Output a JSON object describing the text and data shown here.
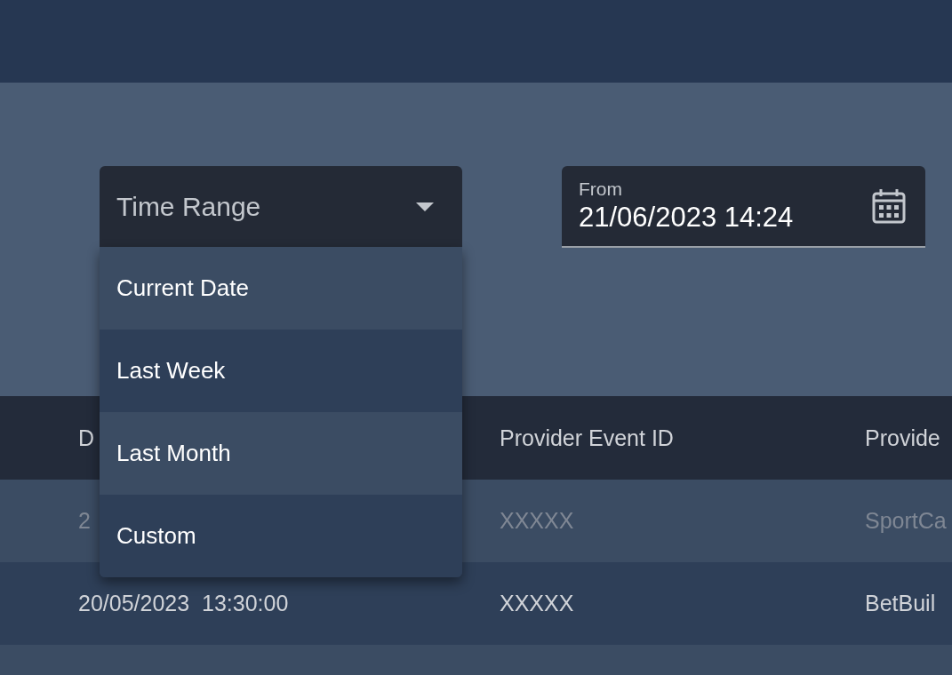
{
  "filter": {
    "time_range": {
      "placeholder": "Time Range",
      "expanded": true,
      "options": [
        {
          "label": "Current Date"
        },
        {
          "label": "Last Week"
        },
        {
          "label": "Last Month"
        },
        {
          "label": "Custom"
        }
      ]
    },
    "from": {
      "label": "From",
      "value": "21/06/2023 14:24"
    }
  },
  "table": {
    "columns": [
      "D",
      "Provider Event ID",
      "Provide"
    ],
    "rows": [
      {
        "disabled": true,
        "cells": [
          "2",
          "XXXXX",
          "SportCa"
        ]
      },
      {
        "disabled": false,
        "cells": [
          "20/05/2023  13:30:00",
          "XXXXX",
          "BetBuil"
        ]
      }
    ]
  }
}
